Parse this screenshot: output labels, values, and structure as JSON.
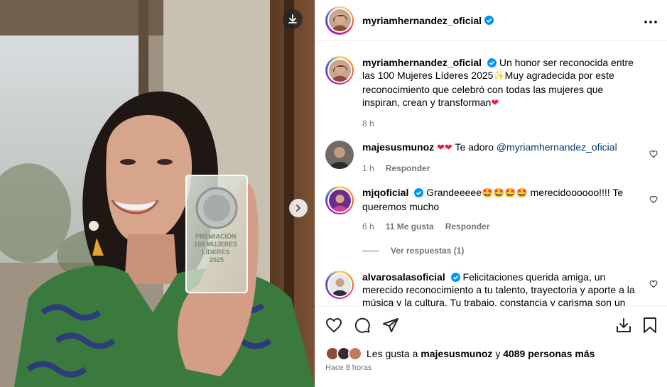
{
  "post": {
    "author": "myriamhernandez_oficial",
    "caption_pre": "Un honor ser reconocida entre las 100 Mujeres Líderes 2025",
    "caption_mid": "Muy agradecida por este reconocimiento que celebró con todas las mujeres que inspiran, crean y transforman",
    "caption_time": "8 h",
    "trophy_text": "PREMIACIÓN 100 MUJERES LÍDERES 2025"
  },
  "comments": [
    {
      "user": "majesusmunoz",
      "text": "Te adoro",
      "mention": "@myriamhernandez_oficial",
      "time": "1 h",
      "reply": "Responder"
    },
    {
      "user": "mjqoficial",
      "text_pre": "Grandeeeee",
      "text_post": "merecidoooooo!!!! Te queremos mucho",
      "time": "6 h",
      "likes": "11 Me gusta",
      "reply": "Responder"
    },
    {
      "user": "alvarosalasoficial",
      "text": "Felicitaciones querida amiga, un merecido reconocimiento a tu talento, trayectoria y aporte a la música y la cultura. Tu trabajo, constancia y carisma son un orgullo para"
    }
  ],
  "view_replies": "Ver respuestas (1)",
  "likes": {
    "prefix": "Les gusta a",
    "user": "majesusmunoz",
    "connector": "y",
    "others": "4089 personas más"
  },
  "posted_ago": "Hace 8 horas",
  "colors": {
    "verified": "#0095f6",
    "mention": "#00376b",
    "muted": "#737373"
  },
  "icons": [
    "download-icon",
    "chevron-right-icon",
    "more-icon",
    "heart-icon",
    "comment-icon",
    "share-icon",
    "save-to-collection-icon",
    "bookmark-icon",
    "verified-icon"
  ]
}
